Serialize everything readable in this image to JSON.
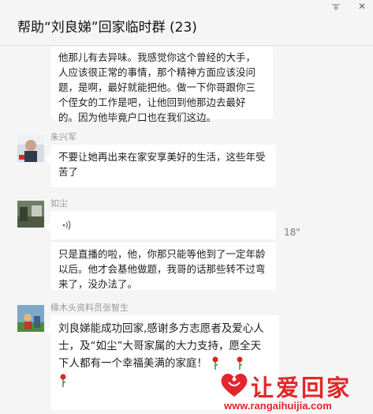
{
  "window": {
    "title": "帮助“刘良娣”回家临时群 (23)",
    "pin_glyph": "ᅎ",
    "close_glyph": "✕"
  },
  "messages": [
    {
      "sender": "",
      "text": "他那儿有去异味。我感觉你这个曾经的大手，人应该很正常的事情，那个精神方面应该没问题，是啊，最好就能把他。做一下你哥跟你三个侄女的工作是吧，让他回到他那边去最好的。因为他毕竟户口也在我们这边。"
    },
    {
      "sender": "朱兴军",
      "text": "不要让她再出来在家安享美好的生活，这些年受苦了"
    },
    {
      "sender": "如尘",
      "voice_duration": "18\"",
      "text": "只是直播的啦，他，你那只能等他到了一定年龄以后。他才会基他做题，我哥的话那些转不过弯来了，没办法了。"
    },
    {
      "sender": "樟木头资料员张智生",
      "text": "刘良娣能成功回家,感谢多方志愿者及爱心人士，及“如尘”大哥家属的大力支持，愿全天下人都有一个幸福美满的家庭！"
    }
  ],
  "watermark": {
    "brand": "让爱回家",
    "url": "www.rangaihuijia.com"
  },
  "colors": {
    "background": "#f5f5f5",
    "bubble": "#ffffff",
    "logo_red": "#e2262b"
  }
}
